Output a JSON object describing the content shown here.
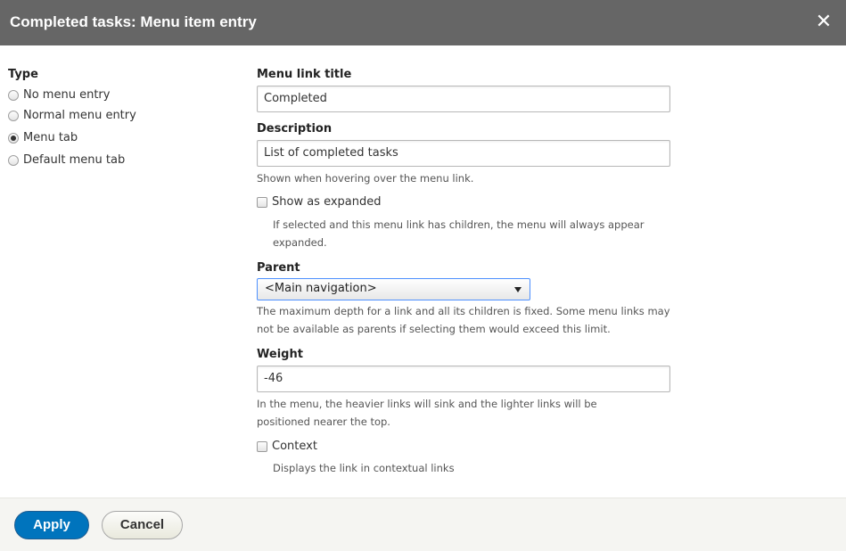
{
  "dialog": {
    "title": "Completed tasks: Menu item entry",
    "close_icon": "close-icon"
  },
  "type": {
    "label": "Type",
    "options": [
      {
        "label": "No menu entry",
        "checked": false
      },
      {
        "label": "Normal menu entry",
        "checked": false
      },
      {
        "label": "Menu tab",
        "checked": true
      },
      {
        "label": "Default menu tab",
        "checked": false
      }
    ]
  },
  "menu_link_title": {
    "label": "Menu link title",
    "value": "Completed"
  },
  "description": {
    "label": "Description",
    "value": "List of completed tasks",
    "help": "Shown when hovering over the menu link."
  },
  "show_as_expanded": {
    "label": "Show as expanded",
    "checked": false,
    "help": "If selected and this menu link has children, the menu will always appear expanded."
  },
  "parent": {
    "label": "Parent",
    "value": "<Main navigation>",
    "help": "The maximum depth for a link and all its children is fixed. Some menu links may not be available as parents if selecting them would exceed this limit."
  },
  "weight": {
    "label": "Weight",
    "value": "-46",
    "help": "In the menu, the heavier links will sink and the lighter links will be positioned nearer the top."
  },
  "context": {
    "label": "Context",
    "checked": false,
    "help": "Displays the link in contextual links"
  },
  "actions": {
    "apply_label": "Apply",
    "cancel_label": "Cancel"
  },
  "colors": {
    "titlebar": "#666666",
    "primary_button": "#0074bd",
    "footer": "#f5f5f2"
  }
}
